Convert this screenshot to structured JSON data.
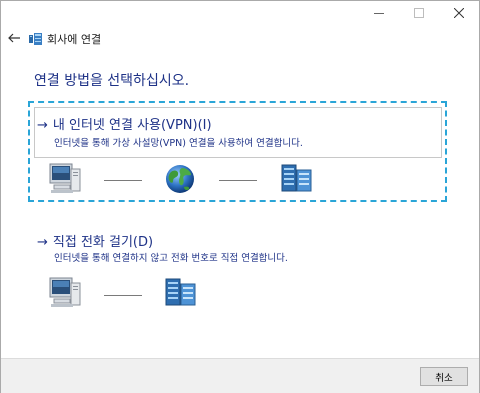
{
  "window": {
    "title": "회사에 연결"
  },
  "heading": "연결 방법을 선택하십시오.",
  "options": [
    {
      "arrow": "→",
      "title": "내 인터넷 연결 사용(VPN)(I)",
      "description": "인터넷을 통해 가상 사설망(VPN) 연결을 사용하여 연결합니다."
    },
    {
      "arrow": "→",
      "title": "직접 전화 걸기(D)",
      "description": "인터넷을 통해 연결하지 않고 전화 번호로 직접 연결합니다."
    }
  ],
  "footer": {
    "cancel_label": "취소"
  },
  "icons": {
    "computer": "computer-icon",
    "globe": "globe-icon",
    "server": "server-icon",
    "back": "back-arrow-icon",
    "title": "workplace-network-icon"
  },
  "colors": {
    "accent": "#1e3287",
    "focus_border": "#2aa5d7"
  }
}
